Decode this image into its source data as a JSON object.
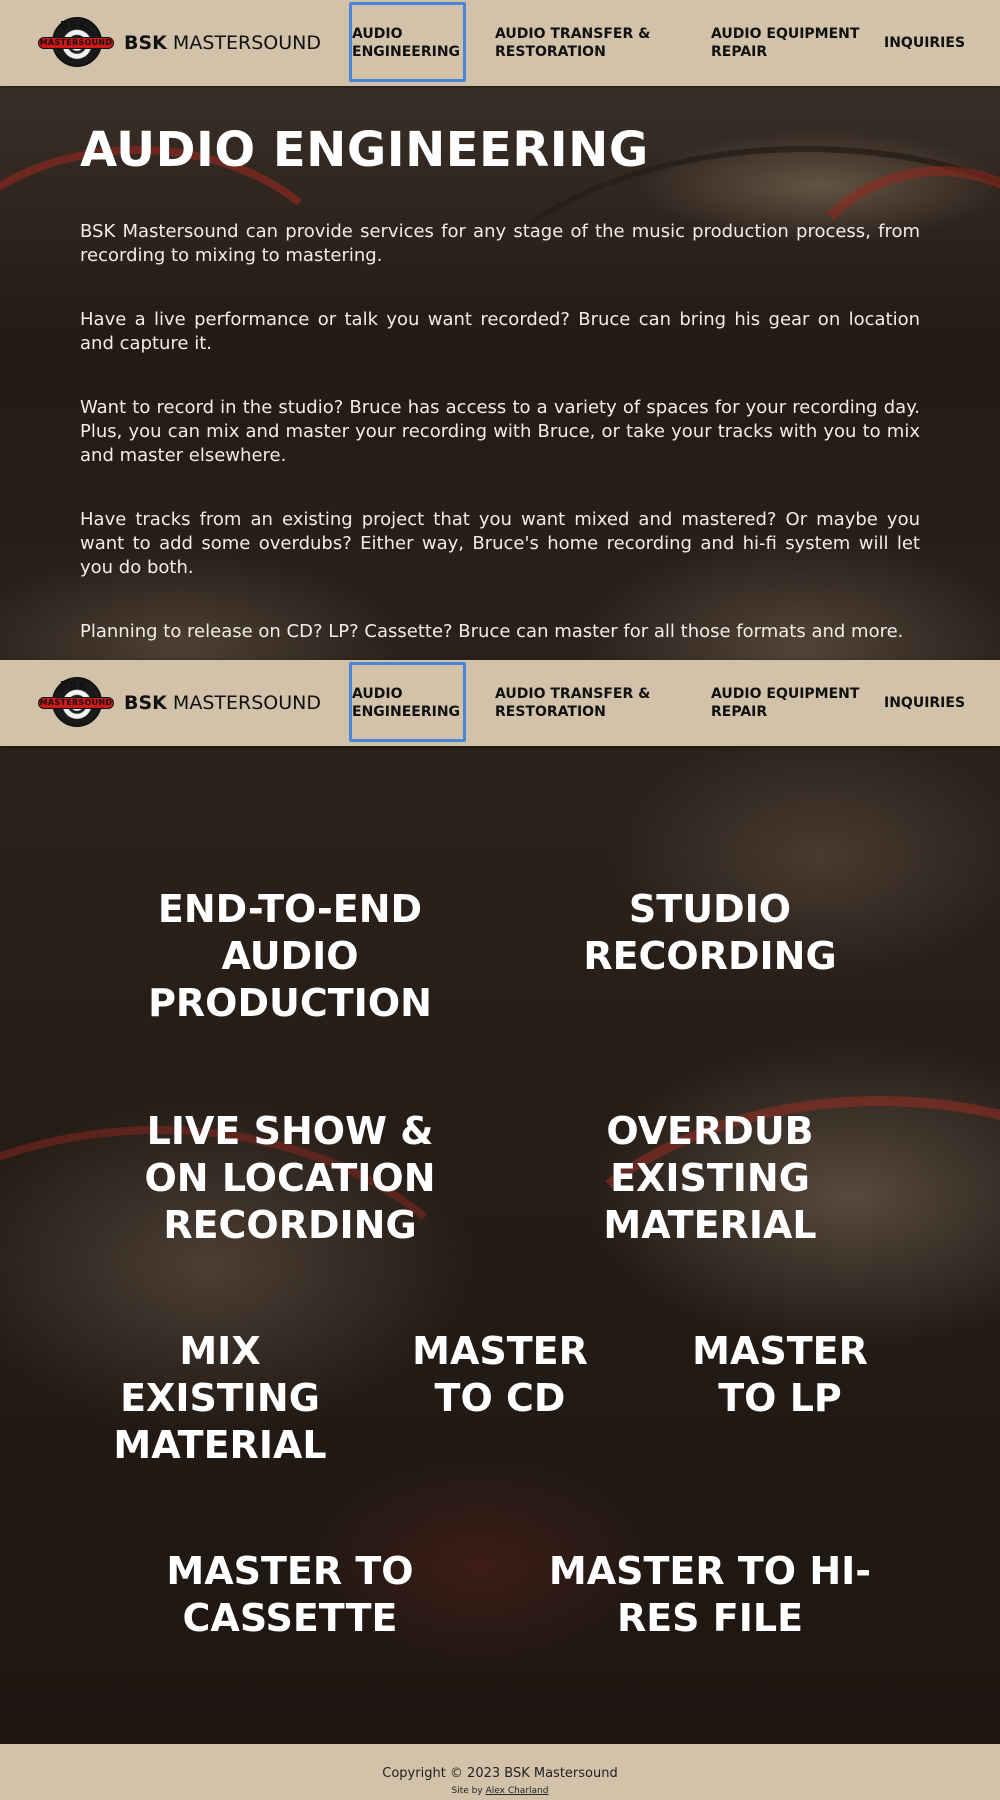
{
  "brand": {
    "logo_top": "BSK",
    "logo_band": "MASTERSOUND",
    "name_bold": "BSK",
    "name_rest": " MASTERSOUND"
  },
  "nav": {
    "items": [
      {
        "label": "Audio Engineering",
        "active": true
      },
      {
        "label": "Audio Transfer & Restoration"
      },
      {
        "label": "Audio Equipment Repair"
      },
      {
        "label": "Inquiries"
      }
    ],
    "active_color": "#4a86d8",
    "bar_color": "#d2c2aa"
  },
  "hero": {
    "title": "AUDIO ENGINEERING",
    "paragraphs": [
      "BSK Mastersound can provide services for any stage of the music production process, from recording to mixing to mastering.",
      "Have a live performance or talk you want recorded? Bruce can bring his gear on location and capture it.",
      "Want to record in the studio? Bruce has access to a variety of spaces for your recording day. Plus, you can mix and master your recording with Bruce, or take your tracks with you to mix and master elsewhere.",
      "Have tracks from an existing project that you want mixed and mastered? Or maybe you want to add some overdubs? Either way, Bruce's home recording and hi-fi system will let you do both.",
      "Planning to release on CD? LP? Cassette? Bruce can master for all those formats and more."
    ]
  },
  "services": [
    "END-TO-END AUDIO PRODUCTION",
    "STUDIO RECORDING",
    "LIVE SHOW & ON LOCATION RECORDING",
    "OVERDUB EXISTING MATERIAL",
    "MIX EXISTING MATERIAL",
    "MASTER TO CD",
    "MASTER TO LP",
    "MASTER TO CASSETTE",
    "MASTER TO HI-RES FILE"
  ],
  "footer": {
    "copyright": "Copyright © 2023 BSK Mastersound",
    "credit_prefix": "Site by ",
    "credit_link": "Alex Charland"
  }
}
